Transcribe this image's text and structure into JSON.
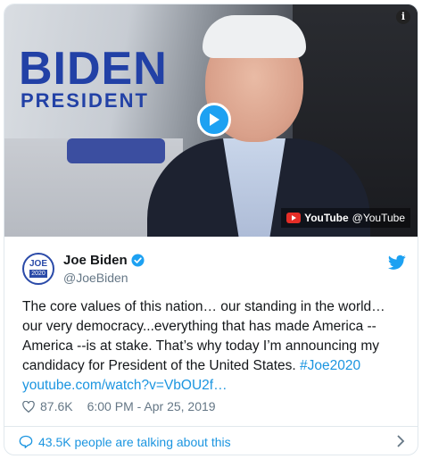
{
  "video": {
    "brand_word": "BIDEN",
    "brand_subtitle": "PRESIDENT",
    "source_name": "YouTube",
    "source_handle": "@YouTube",
    "info_label": "i"
  },
  "author": {
    "avatar_top": "JOE",
    "avatar_bottom": "2020",
    "name": "Joe Biden",
    "handle": "@JoeBiden"
  },
  "tweet": {
    "text": "The core values of this nation… our standing in the world… our very democracy...everything that has made America -- America --is at stake. That’s why today I’m announcing my candidacy for President of the United States.",
    "hashtag": "#Joe2020",
    "link": "youtube.com/watch?v=VbOU2f…"
  },
  "meta": {
    "likes": "87.6K",
    "time": "6:00 PM - Apr 25, 2019"
  },
  "footer": {
    "conversation": "43.5K people are talking about this"
  },
  "colors": {
    "accent": "#1da1f2",
    "link": "#1b95e0",
    "brand_blue": "#2241a6",
    "brand_red": "#e23f3f"
  }
}
